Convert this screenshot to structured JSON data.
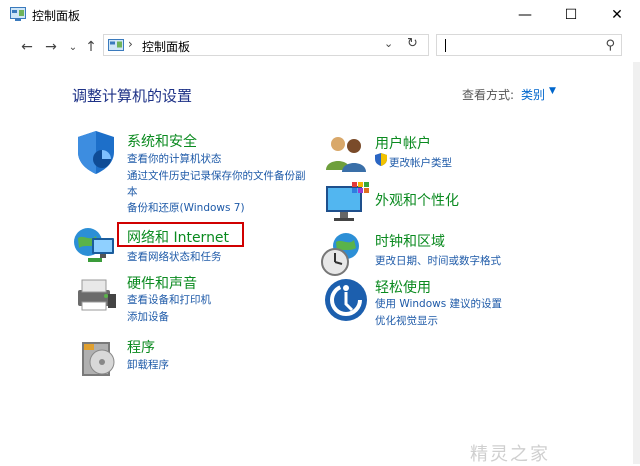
{
  "window": {
    "title": "控制面板",
    "minimize": "—",
    "maximize": "☐",
    "close": "✕"
  },
  "nav": {
    "back": "←",
    "forward": "→",
    "recent": "⌄",
    "up": "↑",
    "address_separator": "›",
    "address": "控制面板",
    "dropdown": "⌄",
    "refresh": "↻",
    "search_placeholder": ""
  },
  "main": {
    "heading": "调整计算机的设置",
    "view_by_label": "查看方式:",
    "view_by_value": "类别",
    "view_by_arrow": "▼"
  },
  "categories_left": [
    {
      "title": "系统和安全",
      "icon": "shield-icon",
      "links": [
        "查看你的计算机状态",
        "通过文件历史记录保存你的文件备份副",
        "本",
        "备份和还原(Windows 7)"
      ]
    },
    {
      "title": "网络和 Internet",
      "icon": "globe-network-icon",
      "links": [
        "查看网络状态和任务"
      ]
    },
    {
      "title": "硬件和声音",
      "icon": "printer-icon",
      "links": [
        "查看设备和打印机",
        "添加设备"
      ]
    },
    {
      "title": "程序",
      "icon": "programs-icon",
      "links": [
        "卸载程序"
      ]
    }
  ],
  "categories_right": [
    {
      "title": "用户帐户",
      "icon": "users-icon",
      "links": [
        "更改帐户类型"
      ]
    },
    {
      "title": "外观和个性化",
      "icon": "appearance-icon",
      "links": []
    },
    {
      "title": "时钟和区域",
      "icon": "clock-globe-icon",
      "links": [
        "更改日期、时间或数字格式"
      ]
    },
    {
      "title": "轻松使用",
      "icon": "ease-of-access-icon",
      "links": [
        "使用 Windows 建议的设置",
        "优化视觉显示"
      ]
    }
  ],
  "watermark": "精灵之家",
  "colors": {
    "heading": "#1e3287",
    "category_title": "#0a8a1f",
    "link": "#1e5aa8",
    "highlight": "#d00000"
  }
}
